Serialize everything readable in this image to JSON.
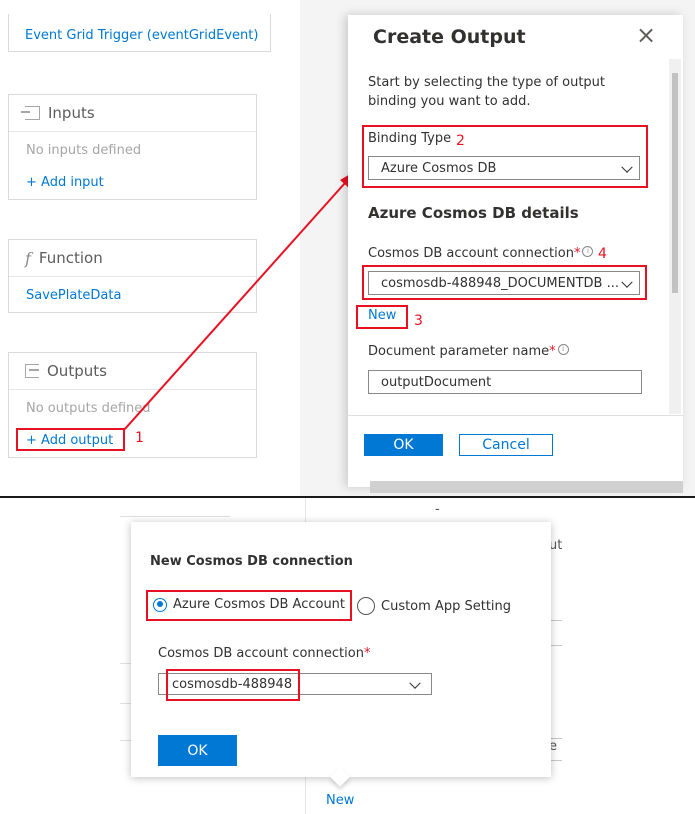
{
  "left_column": {
    "trigger": {
      "label": "Event Grid Trigger (eventGridEvent)"
    },
    "inputs": {
      "title": "Inputs",
      "empty_text": "No inputs defined",
      "add_label": "+ Add input"
    },
    "function": {
      "title": "Function",
      "symbol": "f",
      "item": "SavePlateData"
    },
    "outputs": {
      "title": "Outputs",
      "empty_text": "No outputs defined",
      "add_label": "+ Add output"
    }
  },
  "create_output": {
    "title": "Create Output",
    "close_glyph": "×",
    "description": "Start by selecting the type of output binding you want to add.",
    "binding_type_label": "Binding Type",
    "binding_type_value": "Azure Cosmos DB",
    "details_heading": "Azure Cosmos DB details",
    "connection_label": "Cosmos DB account connection",
    "connection_value": "cosmosdb-488948_DOCUMENTDB ...",
    "new_link": "New",
    "doc_param_label": "Document parameter name",
    "doc_param_value": "outputDocument",
    "required_marker": "*",
    "info_glyph": "i",
    "ok_label": "OK",
    "cancel_label": "Cancel"
  },
  "new_connection": {
    "title": "New Cosmos DB connection",
    "radio_account": "Azure Cosmos DB Account",
    "radio_custom": "Custom App Setting",
    "selected_option": "Azure Cosmos DB Account",
    "connection_label": "Cosmos DB account connection",
    "required_marker": "*",
    "connection_value": "cosmosdb-488948",
    "ok_label": "OK",
    "new_link": "New"
  },
  "background_fragments": {
    "t1": "-",
    "t2": "ut",
    "t3": "e"
  },
  "annotations": {
    "step1": "1",
    "step2": "2",
    "step3": "3",
    "step4": "4"
  },
  "colors": {
    "accent": "#0078d4",
    "annotation_red": "#e81123",
    "border": "#dadada"
  }
}
